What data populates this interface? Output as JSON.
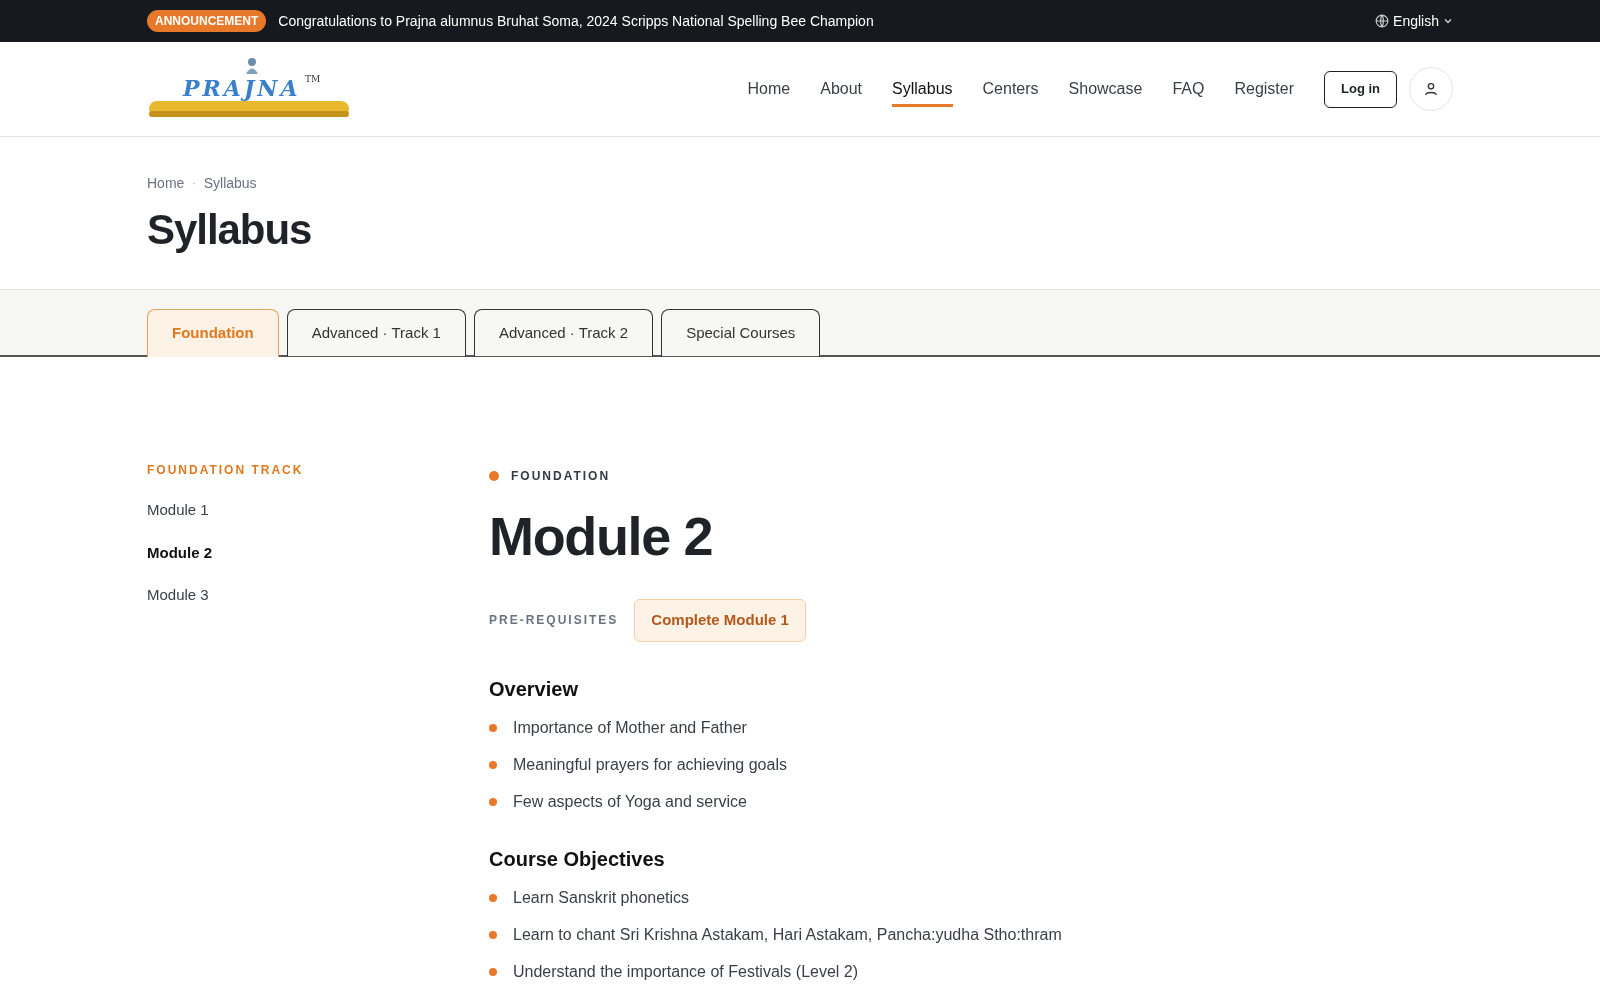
{
  "announcement": {
    "badge": "ANNOUNCEMENT",
    "text": "Congratulations to Prajna alumnus Bruhat Soma, 2024 Scripps National Spelling Bee Champion"
  },
  "language": {
    "label": "English"
  },
  "logo": {
    "wordmark": "PRAJNA",
    "mark": "TM"
  },
  "nav": [
    {
      "label": "Home",
      "selected": false
    },
    {
      "label": "About",
      "selected": false
    },
    {
      "label": "Syllabus",
      "selected": true
    },
    {
      "label": "Centers",
      "selected": false
    },
    {
      "label": "Showcase",
      "selected": false
    },
    {
      "label": "FAQ",
      "selected": false
    },
    {
      "label": "Register",
      "selected": false
    }
  ],
  "login": "Log in",
  "breadcrumb": [
    "Home",
    "Syllabus"
  ],
  "breadcrumb_separator": "·",
  "page_title": "Syllabus",
  "tabs": [
    {
      "label": "Foundation",
      "selected": true
    },
    {
      "label": "Advanced · Track 1",
      "selected": false
    },
    {
      "label": "Advanced · Track 2",
      "selected": false
    },
    {
      "label": "Special Courses",
      "selected": false
    }
  ],
  "sidebar": {
    "heading": "FOUNDATION TRACK",
    "items": [
      {
        "label": "Module 1",
        "selected": false
      },
      {
        "label": "Module 2",
        "selected": true
      },
      {
        "label": "Module 3",
        "selected": false
      }
    ]
  },
  "module": {
    "eyebrow": "FOUNDATION",
    "title": "Module 2",
    "prerequisites_label": "PRE-REQUISITES",
    "prerequisites": [
      "Complete Module 1"
    ],
    "sections": [
      {
        "heading": "Overview",
        "items": [
          "Importance of Mother and Father",
          "Meaningful prayers for achieving goals",
          "Few aspects of Yoga and service"
        ]
      },
      {
        "heading": "Course Objectives",
        "items": [
          "Learn Sanskrit phonetics",
          "Learn to chant Sri Krishna Astakam, Hari Astakam, Pancha:yudha Stho:thram",
          "Understand the importance of Festivals (Level 2)"
        ]
      }
    ]
  }
}
